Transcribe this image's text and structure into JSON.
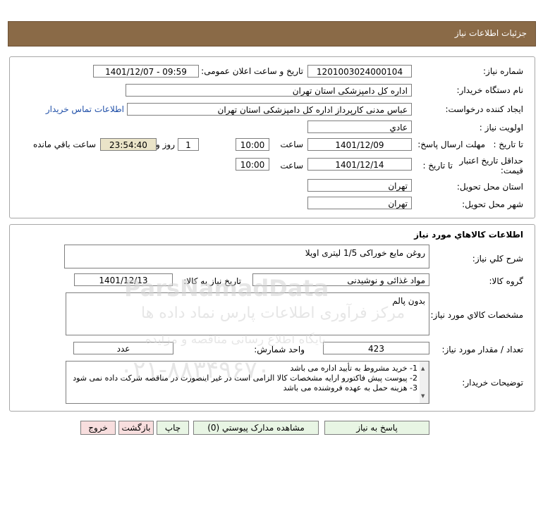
{
  "header": {
    "title": "جزئیات اطلاعات نیاز"
  },
  "need": {
    "number_label": "شماره نیاز:",
    "number": "1201003024000104",
    "announce_label": "تاریخ و ساعت اعلان عمومی:",
    "announce": "1401/12/07 - 09:59",
    "buyer_label": "نام دستگاه خریدار:",
    "buyer": "اداره کل دامپزشکی استان تهران",
    "creator_label": "ایجاد کننده درخواست:",
    "creator": "عباس  مدنی کارپرداز اداره کل دامپزشکی استان تهران",
    "contact_link": "اطلاعات تماس خریدار",
    "priority_label": "اولویت نیاز :",
    "priority": "عادي",
    "deadline_label": "مهلت ارسال پاسخ:",
    "deadline_to": "تا تاریخ :",
    "deadline_date": "1401/12/09",
    "deadline_time_label": "ساعت",
    "deadline_time": "10:00",
    "remain_days": "1",
    "remain_days_label": "روز و",
    "remain_time": "23:54:40",
    "remain_label": "ساعت باقي مانده",
    "validity_label_1": "حداقل تاریخ اعتبار",
    "validity_label_2": "قیمت:",
    "validity_to": "تا تاریخ :",
    "validity_date": "1401/12/14",
    "validity_time_label": "ساعت",
    "validity_time": "10:00",
    "province_label": "استان محل تحویل:",
    "province": "تهران",
    "city_label": "شهر محل تحویل:",
    "city": "تهران"
  },
  "goods": {
    "section_title": "اطلاعات کالاهاي مورد نیاز",
    "desc_label": "شرح کلي نیاز:",
    "desc": "روغن مایع خوراکی 1/5 لیتری اویلا",
    "group_label": "گروه کالا:",
    "group": "مواد غذائی و نوشیدنی",
    "need_date_label": "تاریخ نیاز به کالا:",
    "need_date": "1401/12/13",
    "specs_label": "مشخصات کالاي مورد نیاز:",
    "specs": "بدون پالم",
    "qty_label": "تعداد / مقدار مورد نیاز:",
    "qty": "423",
    "unit_label": "واحد شمارش:",
    "unit": "عدد",
    "notes_label": "توضیحات خریدار:",
    "notes": [
      "1- خرید مشروط به تأیید اداره می باشد",
      "2- پیوست پیش فاکتورو ارایه مشخصات کالا الزامی است در غیر اینصورت در مناقصه شرکت داده نمی شود",
      "3- هزینه حمل به عهده فروشنده می باشد"
    ]
  },
  "buttons": {
    "reply": "پاسخ به نیاز",
    "attachments": "مشاهده مدارک پیوستي (0)",
    "print": "چاپ",
    "back": "بازگشت",
    "exit": "خروج"
  },
  "watermark": {
    "brand": "ParsNamadData",
    "line1": "مرکز فرآوری اطلاعات پارس نماد داده ها",
    "line2": "پایگاه اطلاع رسانی مناقصه و مزایده",
    "phone": "۰۲۱-۸۸۳۴۹۶۷۰"
  }
}
